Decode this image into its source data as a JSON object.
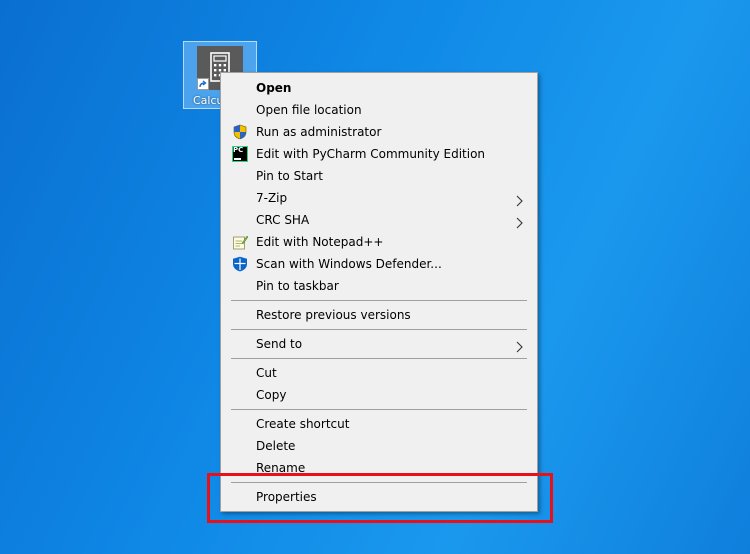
{
  "desktop": {
    "icon": {
      "label": "Calcu",
      "icon_name": "calculator-icon"
    }
  },
  "context_menu": {
    "items": [
      {
        "label": "Open"
      },
      {
        "label": "Open file location"
      },
      {
        "label": "Run as administrator",
        "icon": "uac-shield-icon"
      },
      {
        "label": "Edit with PyCharm Community Edition",
        "icon": "pycharm-icon",
        "icon_text": "PC"
      },
      {
        "label": "Pin to Start"
      },
      {
        "label": "7-Zip"
      },
      {
        "label": "CRC SHA"
      },
      {
        "label": "Edit with Notepad++",
        "icon": "notepad-plus-plus-icon"
      },
      {
        "label": "Scan with Windows Defender...",
        "icon": "windows-defender-icon"
      },
      {
        "label": "Pin to taskbar"
      },
      {
        "label": "Restore previous versions"
      },
      {
        "label": "Send to"
      },
      {
        "label": "Cut"
      },
      {
        "label": "Copy"
      },
      {
        "label": "Create shortcut"
      },
      {
        "label": "Delete"
      },
      {
        "label": "Rename"
      },
      {
        "label": "Properties"
      }
    ]
  },
  "colors": {
    "desktop_background": "#0f88e6",
    "menu_background": "#f0f0f0",
    "highlight_border": "#e8101a"
  }
}
